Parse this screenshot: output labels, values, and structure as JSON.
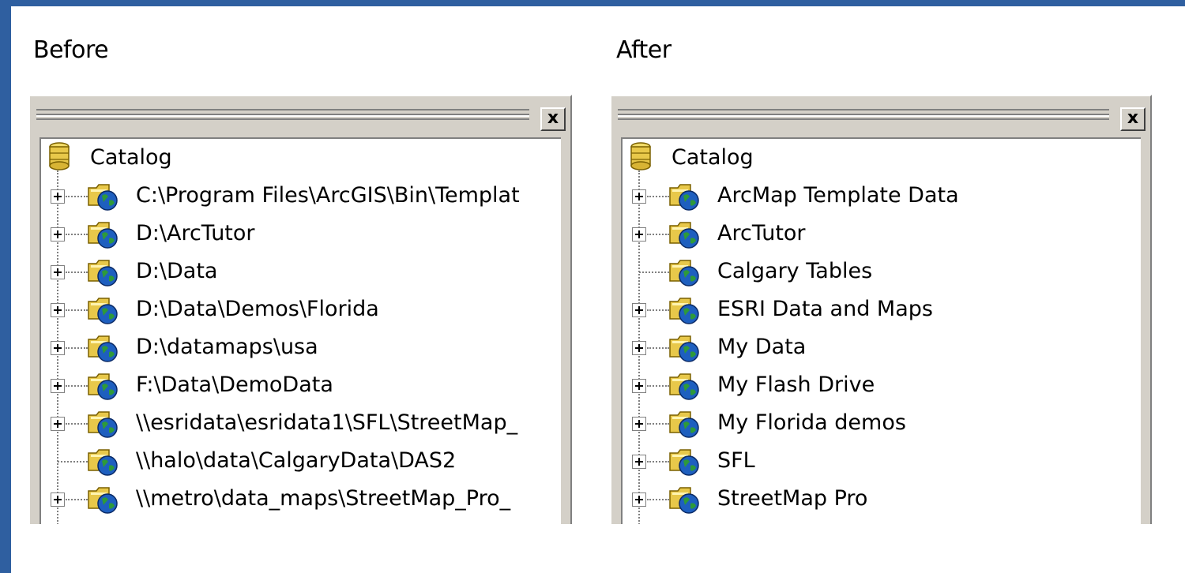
{
  "before": {
    "heading": "Before",
    "close_label": "x",
    "root_label": "Catalog",
    "items": [
      {
        "label": "C:\\Program Files\\ArcGIS\\Bin\\Templat",
        "expandable": true
      },
      {
        "label": "D:\\ArcTutor",
        "expandable": true
      },
      {
        "label": "D:\\Data",
        "expandable": true
      },
      {
        "label": "D:\\Data\\Demos\\Florida",
        "expandable": true
      },
      {
        "label": "D:\\datamaps\\usa",
        "expandable": true
      },
      {
        "label": "F:\\Data\\DemoData",
        "expandable": true
      },
      {
        "label": "\\\\esridata\\esridata1\\SFL\\StreetMap_",
        "expandable": true
      },
      {
        "label": "\\\\halo\\data\\CalgaryData\\DAS2",
        "expandable": false
      },
      {
        "label": "\\\\metro\\data_maps\\StreetMap_Pro_",
        "expandable": true
      }
    ]
  },
  "after": {
    "heading": "After",
    "close_label": "x",
    "root_label": "Catalog",
    "items": [
      {
        "label": "ArcMap Template Data",
        "expandable": true
      },
      {
        "label": "ArcTutor",
        "expandable": true
      },
      {
        "label": "Calgary Tables",
        "expandable": false
      },
      {
        "label": "ESRI Data and Maps",
        "expandable": true
      },
      {
        "label": "My Data",
        "expandable": true
      },
      {
        "label": "My Flash Drive",
        "expandable": true
      },
      {
        "label": "My Florida demos",
        "expandable": true
      },
      {
        "label": "SFL",
        "expandable": true
      },
      {
        "label": "StreetMap Pro",
        "expandable": true
      }
    ]
  },
  "icons": {
    "root": "catalog-icon",
    "item": "folder-connection-icon"
  },
  "colors": {
    "background": "#2f5fa0",
    "panel": "#d4d0c8",
    "folder": "#e8c84a",
    "globe": "#1e5fbf",
    "land": "#2e9a3a"
  }
}
